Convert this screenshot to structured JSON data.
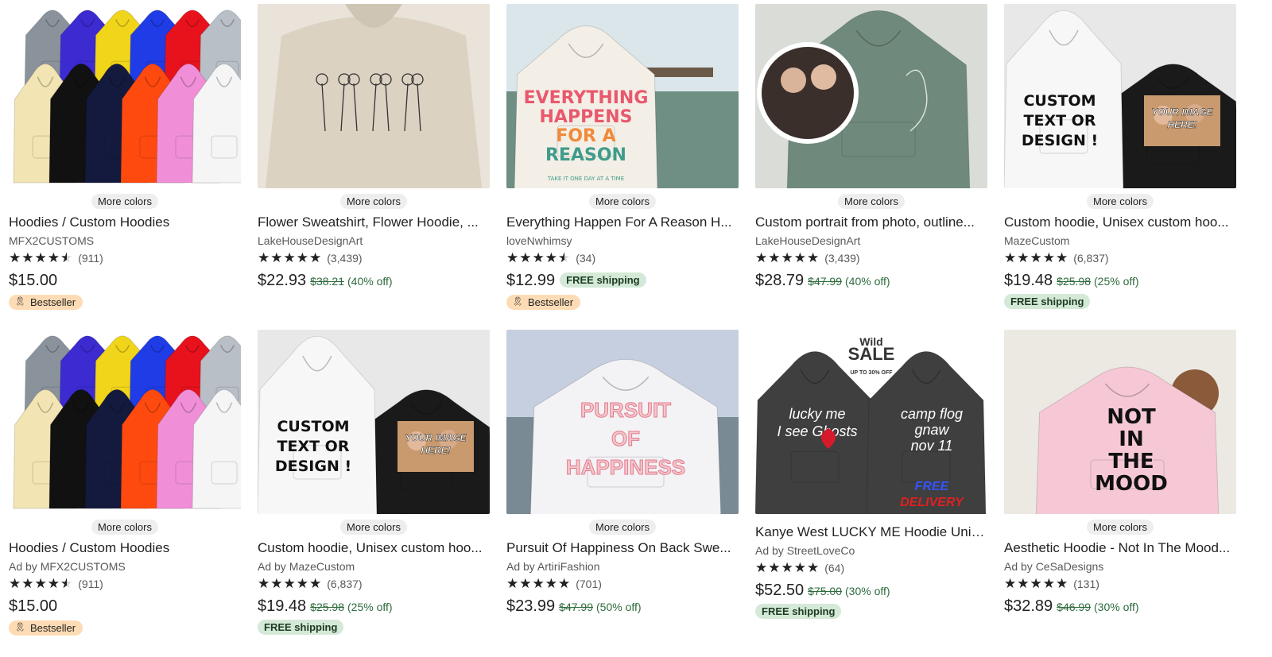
{
  "labels": {
    "more_colors": "More colors",
    "free_shipping": "FREE shipping",
    "bestseller": "Bestseller"
  },
  "colors": {
    "discount_green": "#2f6b3c",
    "free_chip_bg": "#d4e9d7",
    "bestseller_chip_bg": "#fddcb5"
  },
  "listings": [
    {
      "image": "colorful-hoodies",
      "more_colors": true,
      "title": "Hoodies / Custom Hoodies",
      "shop": "MFX2CUSTOMS",
      "stars": "★★★★★",
      "rating": 4.5,
      "reviews": "(911)",
      "price": "$15.00",
      "orig": "",
      "discount": "",
      "free_inline": false,
      "free_below": false,
      "bestseller": true
    },
    {
      "image": "flower-sweatshirt",
      "more_colors": true,
      "title": "Flower Sweatshirt, Flower Hoodie, ...",
      "shop": "LakeHouseDesignArt",
      "stars": "★★★★★",
      "rating": 5,
      "reviews": "(3,439)",
      "price": "$22.93",
      "orig": "$38.21",
      "discount": "(40% off)",
      "free_inline": false,
      "free_below": false,
      "bestseller": false
    },
    {
      "image": "everything-happens-hoodie",
      "more_colors": true,
      "title": "Everything Happen For A Reason H...",
      "shop": "loveNwhimsy",
      "stars": "★★★★★",
      "rating": 4.5,
      "reviews": "(34)",
      "price": "$12.99",
      "orig": "",
      "discount": "",
      "free_inline": true,
      "free_below": false,
      "bestseller": true
    },
    {
      "image": "custom-portrait-hoodie",
      "more_colors": true,
      "title": "Custom portrait from photo, outline...",
      "shop": "LakeHouseDesignArt",
      "stars": "★★★★★",
      "rating": 5,
      "reviews": "(3,439)",
      "price": "$28.79",
      "orig": "$47.99",
      "discount": "(40% off)",
      "free_inline": false,
      "free_below": false,
      "bestseller": false
    },
    {
      "image": "custom-text-hoodie",
      "more_colors": true,
      "title": "Custom hoodie, Unisex custom hoo...",
      "shop": "MazeCustom",
      "stars": "★★★★★",
      "rating": 5,
      "reviews": "(6,837)",
      "price": "$19.48",
      "orig": "$25.98",
      "discount": "(25% off)",
      "free_inline": false,
      "free_below": true,
      "bestseller": false
    },
    {
      "image": "colorful-hoodies",
      "more_colors": true,
      "title": "Hoodies / Custom Hoodies",
      "shop": "Ad by MFX2CUSTOMS",
      "stars": "★★★★★",
      "rating": 4.5,
      "reviews": "(911)",
      "price": "$15.00",
      "orig": "",
      "discount": "",
      "free_inline": false,
      "free_below": false,
      "bestseller": true
    },
    {
      "image": "custom-text-hoodie",
      "more_colors": true,
      "title": "Custom hoodie, Unisex custom hoo...",
      "shop": "Ad by MazeCustom",
      "stars": "★★★★★",
      "rating": 5,
      "reviews": "(6,837)",
      "price": "$19.48",
      "orig": "$25.98",
      "discount": "(25% off)",
      "free_inline": false,
      "free_below": true,
      "bestseller": false
    },
    {
      "image": "pursuit-happiness-hoodie",
      "more_colors": true,
      "title": "Pursuit Of Happiness On Back Swe...",
      "shop": "Ad by ArtiriFashion",
      "stars": "★★★★★",
      "rating": 5,
      "reviews": "(701)",
      "price": "$23.99",
      "orig": "$47.99",
      "discount": "(50% off)",
      "free_inline": false,
      "free_below": false,
      "bestseller": false
    },
    {
      "image": "lucky-me-hoodies",
      "more_colors": false,
      "title": "Kanye West LUCKY ME Hoodie Unis...",
      "shop": "Ad by StreetLoveCo",
      "stars": "★★★★★",
      "rating": 5,
      "reviews": "(64)",
      "price": "$52.50",
      "orig": "$75.00",
      "discount": "(30% off)",
      "free_inline": false,
      "free_below": true,
      "bestseller": false
    },
    {
      "image": "not-in-the-mood-hoodie",
      "more_colors": true,
      "title": "Aesthetic Hoodie - Not In The Mood...",
      "shop": "Ad by CeSaDesigns",
      "stars": "★★★★★",
      "rating": 5,
      "reviews": "(131)",
      "price": "$32.89",
      "orig": "$46.99",
      "discount": "(30% off)",
      "free_inline": false,
      "free_below": false,
      "bestseller": false
    }
  ],
  "artwork": {
    "flower_text": "",
    "everything_text": [
      "EVERYTHING",
      "HAPPENS",
      "FOR A",
      "REASON",
      "TAKE IT ONE DAY AT A TIME"
    ],
    "custom_text": [
      "CUSTOM",
      "TEXT OR",
      "DESIGN !"
    ],
    "your_image_text": [
      "YOUR IMAGE",
      "HERE!"
    ],
    "pursuit_text": [
      "PURSUIT",
      "OF",
      "HAPPINESS"
    ],
    "lucky_text": [
      "lucky me",
      "I see Ghosts"
    ],
    "camp_text": [
      "camp flog",
      "gnaw",
      "nov 11"
    ],
    "sale_text": [
      "Wild",
      "SALE",
      "UP TO 30% OFF"
    ],
    "free_delivery_text": [
      "FREE",
      "DELIVERY"
    ],
    "mood_text": [
      "NOT",
      "IN",
      "THE",
      "MOOD"
    ]
  }
}
